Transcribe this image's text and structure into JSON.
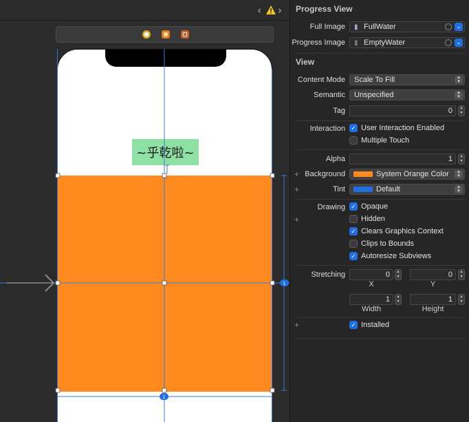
{
  "canvas": {
    "label_text": "~乎乾啦~",
    "constraint_badge_right": "1",
    "constraint_badge_bottom": "1",
    "colors": {
      "orange_view": "#ff8a20",
      "label_bg": "#8fe0a4",
      "guide_line": "#3f7bd4"
    }
  },
  "inspector": {
    "progress_view": {
      "title": "Progress View",
      "full_image_label": "Full Image",
      "full_image_value": "FullWater",
      "progress_image_label": "Progress Image",
      "progress_image_value": "EmptyWater"
    },
    "view": {
      "title": "View",
      "content_mode_label": "Content Mode",
      "content_mode_value": "Scale To Fill",
      "semantic_label": "Semantic",
      "semantic_value": "Unspecified",
      "tag_label": "Tag",
      "tag_value": "0",
      "interaction_label": "Interaction",
      "user_interaction": "User Interaction Enabled",
      "multiple_touch": "Multiple Touch",
      "alpha_label": "Alpha",
      "alpha_value": "1",
      "background_label": "Background",
      "background_value": "System Orange Color",
      "background_color": "#ff8a20",
      "tint_label": "Tint",
      "tint_value": "Default",
      "tint_color": "#1f6fe0",
      "drawing_label": "Drawing",
      "opaque": "Opaque",
      "hidden": "Hidden",
      "clears_graphics": "Clears Graphics Context",
      "clips_bounds": "Clips to Bounds",
      "autoresize": "Autoresize Subviews",
      "stretching_label": "Stretching",
      "stretch_x_value": "0",
      "stretch_y_value": "0",
      "stretch_x_caption": "X",
      "stretch_y_caption": "Y",
      "stretch_w_value": "1",
      "stretch_h_value": "1",
      "stretch_w_caption": "Width",
      "stretch_h_caption": "Height",
      "installed": "Installed"
    }
  }
}
